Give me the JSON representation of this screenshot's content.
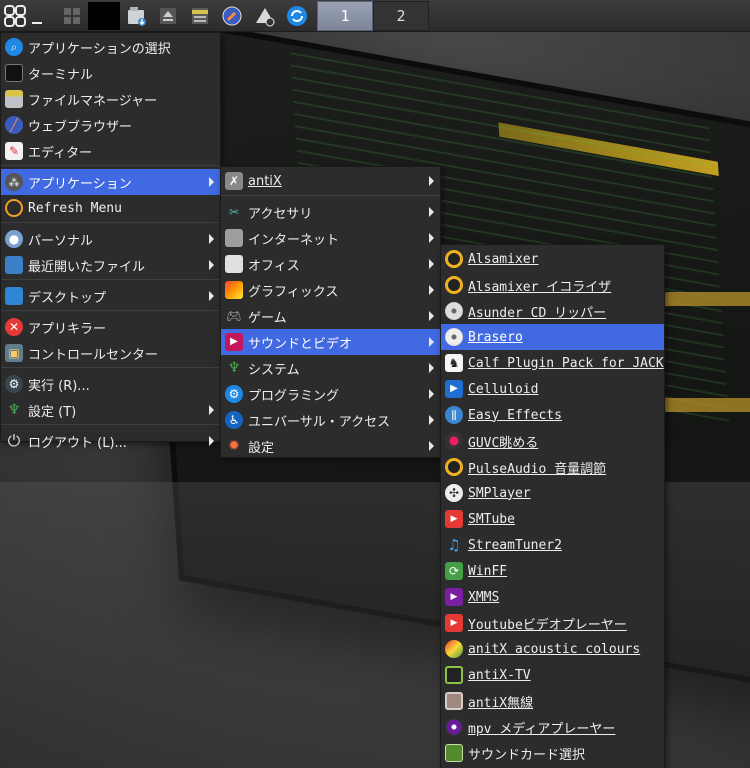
{
  "taskbar": {
    "workspaces": [
      "1",
      "2"
    ],
    "active_workspace": "1",
    "launchers": [
      "menu-icon",
      "show-desktop-icon",
      "pager-icon",
      "blank-window-icon",
      "file-manager-icon",
      "eject-icon",
      "files-icon",
      "browser-icon",
      "drive-icon",
      "update-icon"
    ]
  },
  "main_menu": {
    "items": [
      {
        "label": "アプリケーションの選択",
        "icon": "app-search-icon"
      },
      {
        "label": "ターミナル",
        "icon": "terminal-icon"
      },
      {
        "label": "ファイルマネージャー",
        "icon": "file-manager-icon"
      },
      {
        "label": "ウェブブラウザー",
        "icon": "web-browser-icon"
      },
      {
        "label": "エディター",
        "icon": "editor-icon"
      },
      {
        "label": "アプリケーション",
        "icon": "applications-icon",
        "submenu": true,
        "highlighted": true
      },
      {
        "label": "Refresh Menu",
        "icon": "refresh-icon"
      },
      {
        "label": "パーソナル",
        "icon": "personal-icon",
        "submenu": true
      },
      {
        "label": "最近開いたファイル",
        "icon": "recent-files-icon",
        "submenu": true
      },
      {
        "label": "デスクトップ",
        "icon": "desktop-icon",
        "submenu": true
      },
      {
        "label": "アプリキラー",
        "icon": "app-killer-icon"
      },
      {
        "label": "コントロールセンター",
        "icon": "control-center-icon"
      },
      {
        "label": "実行 (R)...",
        "icon": "run-icon"
      },
      {
        "label": "設定 (T)",
        "icon": "settings-icon",
        "submenu": true
      },
      {
        "label": "ログアウト (L)...",
        "icon": "power-icon",
        "submenu": true
      }
    ]
  },
  "apps_menu": {
    "items": [
      {
        "label": "antiX",
        "icon": "antix-icon"
      },
      {
        "label": "アクセサリ",
        "icon": "accessories-icon"
      },
      {
        "label": "インターネット",
        "icon": "internet-icon"
      },
      {
        "label": "オフィス",
        "icon": "office-icon"
      },
      {
        "label": "グラフィックス",
        "icon": "graphics-icon"
      },
      {
        "label": "ゲーム",
        "icon": "games-icon"
      },
      {
        "label": "サウンドとビデオ",
        "icon": "sound-video-icon",
        "highlighted": true
      },
      {
        "label": "システム",
        "icon": "system-icon"
      },
      {
        "label": "プログラミング",
        "icon": "programming-icon"
      },
      {
        "label": "ユニバーサル・アクセス",
        "icon": "accessibility-icon"
      },
      {
        "label": "設定",
        "icon": "settings-icon"
      }
    ]
  },
  "sound_menu": {
    "items": [
      {
        "label": "Alsamixer",
        "icon": "alsamixer-icon"
      },
      {
        "label": "Alsamixer イコライザ",
        "icon": "equalizer-icon"
      },
      {
        "label": "Asunder CD リッパー",
        "icon": "cd-ripper-icon"
      },
      {
        "label": "Brasero",
        "icon": "brasero-icon",
        "highlighted": true
      },
      {
        "label": "Calf Plugin Pack for JACK",
        "icon": "calf-icon"
      },
      {
        "label": "Celluloid",
        "icon": "celluloid-icon"
      },
      {
        "label": "Easy Effects",
        "icon": "easy-effects-icon"
      },
      {
        "label": "GUVC眺める",
        "icon": "webcam-icon"
      },
      {
        "label": "PulseAudio 音量調節",
        "icon": "pulseaudio-icon"
      },
      {
        "label": "SMPlayer",
        "icon": "smplayer-icon"
      },
      {
        "label": "SMTube",
        "icon": "smtube-icon"
      },
      {
        "label": "StreamTuner2",
        "icon": "streamtuner-icon"
      },
      {
        "label": "WinFF",
        "icon": "winff-icon"
      },
      {
        "label": "XMMS",
        "icon": "xmms-icon"
      },
      {
        "label": "Youtubeビデオプレーヤー",
        "icon": "youtube-icon"
      },
      {
        "label": "anitX acoustic colours",
        "icon": "acoustic-colours-icon"
      },
      {
        "label": "antiX-TV",
        "icon": "tv-icon"
      },
      {
        "label": "antiX無線",
        "icon": "radio-icon"
      },
      {
        "label": "mpv メディアプレーヤー",
        "icon": "mpv-icon"
      },
      {
        "label": "サウンドカード選択",
        "icon": "soundcard-icon"
      }
    ]
  },
  "colors": {
    "highlight": "#4169e1",
    "menu_bg": "#2c2c2c",
    "taskbar_bg": "#333333",
    "workspace_active": "#8890a4"
  }
}
